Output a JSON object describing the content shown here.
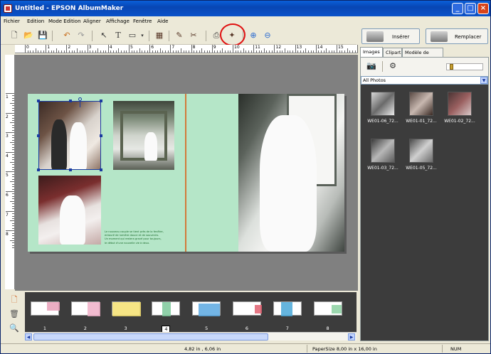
{
  "window": {
    "title": "Untitled - EPSON AlbumMaker"
  },
  "menu": [
    "Fichier",
    "Edition",
    "Mode Edition",
    "Aligner",
    "Affichage",
    "Fenêtre",
    "Aide"
  ],
  "toolbar_icons": [
    "new-icon",
    "open-icon",
    "save-icon",
    "undo-icon",
    "redo-icon",
    "select-arrow-icon",
    "text-tool-icon",
    "shape-tool-icon",
    "image-frame-icon",
    "edit-photo-icon",
    "trim-icon",
    "print-icon",
    "auto-layout-icon",
    "zoom-in-icon",
    "zoom-out-icon"
  ],
  "ruler": {
    "h_numbers": [
      "0",
      "1",
      "2",
      "3",
      "4",
      "5",
      "6",
      "7",
      "8",
      "9",
      "10",
      "11",
      "12",
      "13",
      "14",
      "15",
      "16"
    ],
    "v_numbers": [
      "1",
      "2",
      "3",
      "4",
      "5",
      "6",
      "7",
      "8"
    ]
  },
  "caption_lines": [
    "Le nouveau couple se tient près de la fenêtre,",
    "entouré de lumière douce et de souvenirs.",
    "Un moment qui restera gravé pour toujours,",
    "le début d'une nouvelle vie à deux."
  ],
  "pages": [
    {
      "num": "1",
      "accent": "#e8a0b8"
    },
    {
      "num": "2",
      "accent": "#f0b0c8"
    },
    {
      "num": "3",
      "accent": "#f4e070"
    },
    {
      "num": "4",
      "accent": "#7cc89a",
      "selected": true
    },
    {
      "num": "5",
      "accent": "#5aa8e0"
    },
    {
      "num": "6",
      "accent": "#e06070"
    },
    {
      "num": "7",
      "accent": "#4aa8d8"
    },
    {
      "num": "8",
      "accent": "#8ad0a0"
    }
  ],
  "right": {
    "insert_label": "Insérer",
    "replace_label": "Remplacer",
    "tabs": [
      "Images",
      "Clipart",
      "Modèle de page"
    ],
    "filter": "All Photos",
    "images": [
      {
        "name": "WE01-06_72..."
      },
      {
        "name": "WE01-01_72..."
      },
      {
        "name": "WE01-02_72..."
      },
      {
        "name": "WE01-03_72..."
      },
      {
        "name": "WE01-05_72..."
      }
    ]
  },
  "status": {
    "position": "4,82 in , 6,06 in",
    "papersize": "PaperSize  8,00 in x 16,00 in",
    "num": "NUM"
  }
}
